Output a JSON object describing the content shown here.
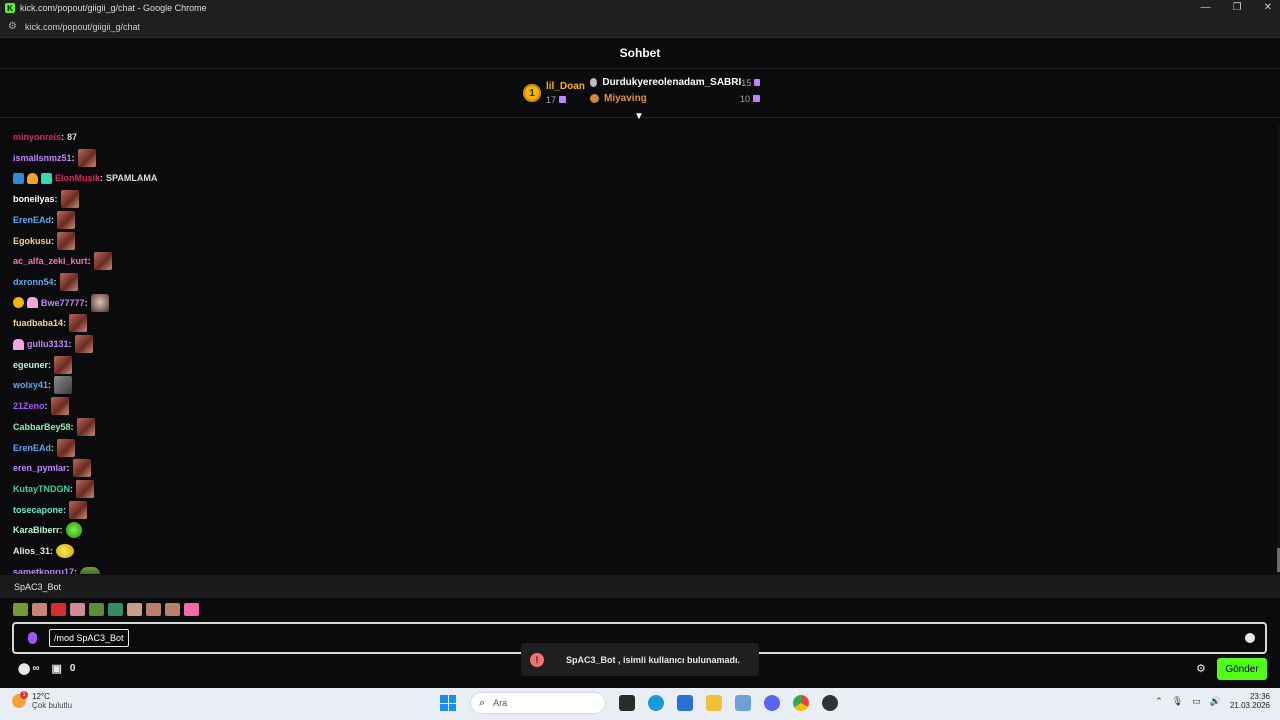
{
  "window": {
    "title": "kick.com/popout/giigii_g/chat - Google Chrome",
    "url": "kick.com/popout/giigii_g/chat",
    "controls": [
      "—",
      "❐",
      "✕"
    ]
  },
  "chat": {
    "header": "Sohbet",
    "leaderboard": {
      "first": {
        "rank": "1",
        "name": "lil_Doan",
        "count": "17"
      },
      "others": [
        {
          "name": "Durdukyereolenadam_SABRI",
          "count": "15"
        },
        {
          "name": "Miyaving",
          "count": "10"
        }
      ]
    },
    "messages": [
      {
        "user": "minyonreis",
        "color": "#e0245e",
        "text": "87",
        "emote": ""
      },
      {
        "user": "ismailsnmz51",
        "color": "#c084fc",
        "text": "",
        "emote": "red"
      },
      {
        "user": "ElonMusik",
        "color": "#e0245e",
        "text": "SPAMLAMA",
        "emote": "",
        "badges": [
          "blue",
          "orange",
          "teal"
        ]
      },
      {
        "user": "boneilyas",
        "color": "#ffffff",
        "text": "",
        "emote": "red"
      },
      {
        "user": "ErenEAd",
        "color": "#5aa9f0",
        "text": "",
        "emote": "red"
      },
      {
        "user": "Egokusu",
        "color": "#f8d28a",
        "text": "",
        "emote": "red"
      },
      {
        "user": "ac_alfa_zeki_kurt",
        "color": "#f472b6",
        "text": "",
        "emote": "red"
      },
      {
        "user": "dxronn54",
        "color": "#5aa9f0",
        "text": "",
        "emote": "red"
      },
      {
        "user": "Bwe77777",
        "color": "#c084fc",
        "text": "",
        "emote": "face",
        "badges": [
          "gold",
          "pink"
        ]
      },
      {
        "user": "fuadbaba14",
        "color": "#f8d28a",
        "text": "",
        "emote": "red"
      },
      {
        "user": "gullu3131",
        "color": "#c084fc",
        "text": "",
        "emote": "red",
        "badges": [
          "pink"
        ]
      },
      {
        "user": "egeuner",
        "color": "#b7f5d8",
        "text": "",
        "emote": "red"
      },
      {
        "user": "wolxy41",
        "color": "#5aa9f0",
        "text": "",
        "emote": "gray"
      },
      {
        "user": "21Zeno",
        "color": "#a855f7",
        "text": "",
        "emote": "red"
      },
      {
        "user": "CabbarBey58",
        "color": "#86efac",
        "text": "",
        "emote": "red"
      },
      {
        "user": "ErenEAd",
        "color": "#5aa9f0",
        "text": "",
        "emote": "red"
      },
      {
        "user": "eren_pymlar",
        "color": "#c084fc",
        "text": "",
        "emote": "red"
      },
      {
        "user": "KutayTNDGN",
        "color": "#34d399",
        "text": "",
        "emote": "red"
      },
      {
        "user": "tosecapone",
        "color": "#5eead4",
        "text": "",
        "emote": "red"
      },
      {
        "user": "KaraBiberr",
        "color": "#bbf7d0",
        "text": "",
        "emote": "green"
      },
      {
        "user": "Alios_31",
        "color": "#e8e8e8",
        "text": "",
        "emote": "yellow"
      },
      {
        "user": "sametkopru17",
        "color": "#c084fc",
        "text": "",
        "emote": "frog"
      }
    ],
    "reply_to": "SpAC3_Bot",
    "emote_row_colors": [
      "#6f9a3a",
      "#c9837a",
      "#d42d2d",
      "#d08a98",
      "#5f8a3a",
      "#3a8a5f",
      "#c8a08a",
      "#b8806a",
      "#b8806a",
      "#f06ca8"
    ],
    "input_value": "/mod SpAC3_Bot",
    "toast": {
      "icon": "!",
      "text": "SpAC3_Bot , isimli kullanıcı bulunamadı."
    },
    "footer": {
      "infinity": "∞",
      "gift_count": "0",
      "send_label": "Gönder"
    }
  },
  "taskbar": {
    "weather_temp": "12°C",
    "weather_desc": "Çok bulutlu",
    "weather_badge": "1",
    "search_placeholder": "Ara",
    "time": "23:36",
    "date": "21.03.2026"
  }
}
